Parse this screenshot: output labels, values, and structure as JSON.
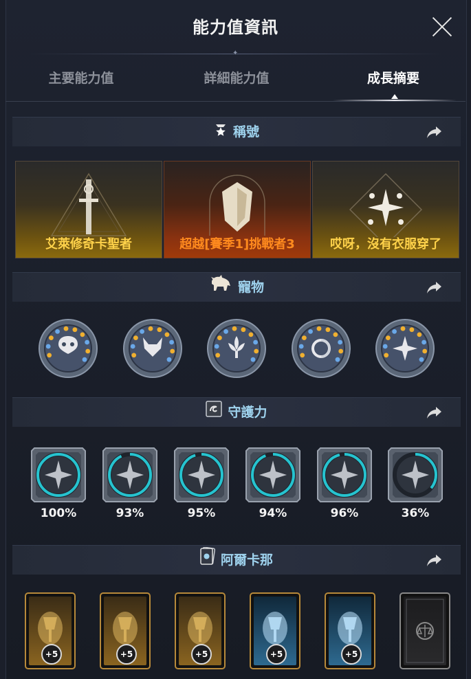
{
  "window": {
    "title": "能力值資訊"
  },
  "tabs": [
    {
      "label": "主要能力值",
      "active": false
    },
    {
      "label": "詳細能力值",
      "active": false
    },
    {
      "label": "成長摘要",
      "active": true
    }
  ],
  "sections": {
    "titles": {
      "label": "稱號",
      "items": [
        {
          "name": "艾萊修奇卡聖者",
          "theme": "gold",
          "icon": "sword-triangle-icon"
        },
        {
          "name": "超越[賽季1]挑戰者3",
          "theme": "fire",
          "icon": "shield-emblem-icon"
        },
        {
          "name": "哎呀，沒有衣服穿了",
          "theme": "gold",
          "icon": "star-diamond-icon"
        }
      ]
    },
    "pets": {
      "label": "寵物",
      "items": [
        {
          "icon": "owl-mask-icon"
        },
        {
          "icon": "wolf-head-icon"
        },
        {
          "icon": "lotus-icon"
        },
        {
          "icon": "swirl-sun-icon"
        },
        {
          "icon": "compass-star-icon"
        }
      ]
    },
    "guardian": {
      "label": "守護力",
      "items": [
        {
          "percent_label": "100%",
          "progress": 1.0,
          "icon": "sword-shield-icon"
        },
        {
          "percent_label": "93%",
          "progress": 0.93,
          "icon": "crossed-blades-icon"
        },
        {
          "percent_label": "95%",
          "progress": 0.95,
          "icon": "bird-wing-icon"
        },
        {
          "percent_label": "94%",
          "progress": 0.94,
          "icon": "crossed-swords-icon"
        },
        {
          "percent_label": "96%",
          "progress": 0.96,
          "icon": "star-burst-icon"
        },
        {
          "percent_label": "36%",
          "progress": 0.36,
          "icon": "crescent-moon-icon"
        }
      ]
    },
    "arcana": {
      "label": "阿爾卡那",
      "items": [
        {
          "badge": "+5",
          "theme": "gold",
          "icon": "chalice-card-icon"
        },
        {
          "badge": "+5",
          "theme": "gold",
          "icon": "scroll-card-icon"
        },
        {
          "badge": "+5",
          "theme": "gold",
          "icon": "candle-card-icon"
        },
        {
          "badge": "+5",
          "theme": "ice",
          "icon": "ice-flame-card-icon"
        },
        {
          "badge": "+5",
          "theme": "ice",
          "icon": "water-portal-card-icon"
        },
        {
          "badge": "",
          "theme": "empty",
          "icon": "scales-card-icon"
        }
      ]
    }
  },
  "colors": {
    "section_text": "#9fd3ee",
    "title_gold": "#ffd24a",
    "title_fire": "#ff8a1e",
    "ring": "#26c3cf"
  }
}
